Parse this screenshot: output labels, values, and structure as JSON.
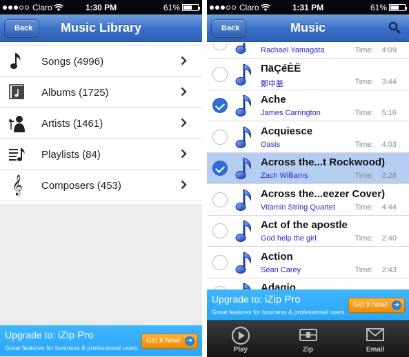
{
  "left_screen": {
    "status": {
      "carrier": "Claro",
      "time": "1:30 PM",
      "battery": "61%",
      "battery_level": 0.61
    },
    "nav": {
      "back_label": "Back",
      "title": "Music Library"
    },
    "library_items": [
      {
        "icon": "music-note-icon",
        "label": "Songs (4996)"
      },
      {
        "icon": "album-icon",
        "label": "Albums (1725)"
      },
      {
        "icon": "artist-icon",
        "label": "Artists (1461)"
      },
      {
        "icon": "playlist-icon",
        "label": "Playlists (84)"
      },
      {
        "icon": "treble-clef-icon",
        "label": "Composers (453)"
      }
    ],
    "ad": {
      "title_prefix": "Upgrade to:",
      "title_product": "iZip Pro",
      "subtitle": "Great features for business & professional users.",
      "button": "Get It Now!"
    }
  },
  "right_screen": {
    "status": {
      "carrier": "Claro",
      "time": "1:31 PM",
      "battery": "61%",
      "battery_level": 0.61
    },
    "nav": {
      "back_label": "Back",
      "title": "Music"
    },
    "time_label": "Time:",
    "songs": [
      {
        "title": "",
        "artist": "Rachael Yamagata",
        "time": "4:09",
        "selected": false
      },
      {
        "title": "ПäÇéÈË",
        "artist": "鄭中基",
        "time": "3:44",
        "selected": false
      },
      {
        "title": "Ache",
        "artist": "James Carrington",
        "time": "5:16",
        "selected": true
      },
      {
        "title": "Acquiesce",
        "artist": "Oasis",
        "time": "4:03",
        "selected": false
      },
      {
        "title": "Across the...t Rockwood)",
        "artist": "Zach Williams",
        "time": "3:28",
        "selected": true,
        "highlighted": true
      },
      {
        "title": "Across the...eezer Cover)",
        "artist": "Vitamin String Quartet",
        "time": "4:44",
        "selected": false
      },
      {
        "title": "Act of the apostle",
        "artist": "God help the girl",
        "time": "2:40",
        "selected": false
      },
      {
        "title": "Action",
        "artist": "Sean Carey",
        "time": "2:43",
        "selected": false
      },
      {
        "title": "Adagio",
        "artist": "",
        "time": "",
        "selected": false
      }
    ],
    "ad": {
      "title_prefix": "Upgrade to:",
      "title_product": "iZip Pro",
      "subtitle": "Great features for business & professional users.",
      "button": "Get It Now!"
    },
    "tabs": [
      {
        "icon": "play-icon",
        "label": "Play"
      },
      {
        "icon": "zip-icon",
        "label": "Zip"
      },
      {
        "icon": "email-icon",
        "label": "Email"
      }
    ]
  },
  "colors": {
    "nav_blue": "#3a6fc6",
    "ad_blue": "#2aa6f5",
    "artist_blue": "#2626c8",
    "selected_row": "#b5cdf0",
    "check_blue": "#2f6fcf"
  }
}
